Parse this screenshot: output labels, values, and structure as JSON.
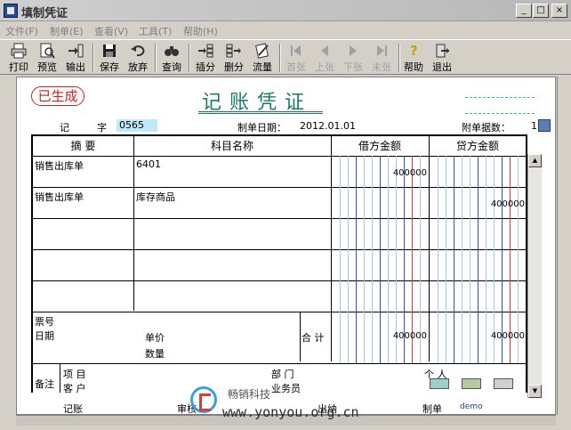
{
  "window": {
    "title": "填制凭证",
    "controls": [
      "_",
      "□",
      "×"
    ]
  },
  "menu": [
    {
      "label": "文件(F)"
    },
    {
      "label": "制单(E)"
    },
    {
      "label": "查看(V)"
    },
    {
      "label": "工具(T)"
    },
    {
      "label": "帮助(H)"
    }
  ],
  "toolbar": [
    {
      "label": "打印",
      "icon": "printer-icon",
      "enabled": true
    },
    {
      "label": "预览",
      "icon": "preview-icon",
      "enabled": true
    },
    {
      "label": "输出",
      "icon": "export-icon",
      "enabled": true
    },
    {
      "label": "保存",
      "icon": "save-icon",
      "enabled": true
    },
    {
      "label": "放弃",
      "icon": "undo-icon",
      "enabled": true
    },
    {
      "label": "查询",
      "icon": "binoculars-icon",
      "enabled": true
    },
    {
      "label": "插分",
      "icon": "insert-row-icon",
      "enabled": true
    },
    {
      "label": "删分",
      "icon": "delete-row-icon",
      "enabled": true
    },
    {
      "label": "流量",
      "icon": "cashflow-icon",
      "enabled": true
    },
    {
      "label": "首张",
      "icon": "first-icon",
      "enabled": false
    },
    {
      "label": "上张",
      "icon": "prev-icon",
      "enabled": false
    },
    {
      "label": "下张",
      "icon": "next-icon",
      "enabled": false
    },
    {
      "label": "末张",
      "icon": "last-icon",
      "enabled": false
    },
    {
      "label": "帮助",
      "icon": "help-icon",
      "enabled": true
    },
    {
      "label": "退出",
      "icon": "exit-icon",
      "enabled": true
    }
  ],
  "voucher": {
    "stamp": "已生成",
    "title": "记账凭证",
    "type_label": "记",
    "number_label": "字",
    "number": "0565",
    "date_label": "制单日期：",
    "date": "2012.01.01",
    "attach_label": "附单据数：",
    "attach_count": "1",
    "columns": {
      "summary": "摘 要",
      "account": "科目名称",
      "debit": "借方金额",
      "credit": "贷方金额"
    },
    "rows": [
      {
        "summary": "销售出库单",
        "account": "6401",
        "debit": "400000",
        "credit": ""
      },
      {
        "summary": "销售出库单",
        "account": "库存商品",
        "debit": "",
        "credit": "400000"
      },
      {
        "summary": "",
        "account": "",
        "debit": "",
        "credit": ""
      },
      {
        "summary": "",
        "account": "",
        "debit": "",
        "credit": ""
      },
      {
        "summary": "",
        "account": "",
        "debit": "",
        "credit": ""
      }
    ],
    "bill_no_label": "票号",
    "date_line_label": "日期",
    "unit_price_label": "单价",
    "quantity_label": "数量",
    "total_label": "合 计",
    "total_debit": "400000",
    "total_credit": "400000",
    "remark_label": "备注",
    "project_label": "项 目",
    "department_label": "部 门",
    "person_label": "个 人",
    "customer_label": "客 户",
    "salesman_label": "业务员",
    "bookkeeper_label": "记账",
    "auditor_label": "审核",
    "cashier_label": "出纳",
    "maker_label": "制单",
    "maker": "demo"
  },
  "watermark": {
    "text": "www.yonyou.org.cn",
    "brand": "畅销科技"
  }
}
